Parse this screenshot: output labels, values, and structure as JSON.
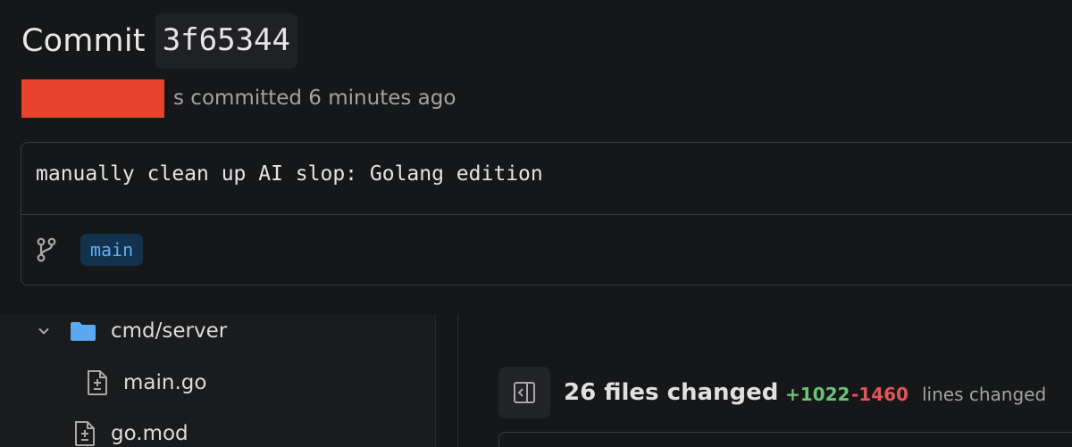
{
  "commit": {
    "title_word": "Commit",
    "sha": "3f65344",
    "author": "",
    "committed_text": "s committed 6 minutes ago",
    "message": "manually clean up AI slop: Golang edition",
    "branch": "main"
  },
  "file_tree": {
    "items": [
      {
        "label": "cmd/server",
        "type": "folder",
        "expanded": true,
        "icon": "folder-icon"
      },
      {
        "label": "main.go",
        "type": "file",
        "icon": "file-diff-icon"
      },
      {
        "label": "go.mod",
        "type": "file",
        "icon": "file-diff-icon"
      }
    ]
  },
  "summary": {
    "files_changed": "26 files changed",
    "additions": "+1022",
    "deletions": "-1460",
    "lines_changed_label": "lines changed",
    "toggle_icon": "sidebar-collapse-icon"
  },
  "colors": {
    "background": "#161718",
    "redaction": "#e8432b",
    "branch_bg": "#13324d",
    "branch_text": "#61aef5",
    "additions": "#6cc27a",
    "deletions": "#e0565b",
    "folder": "#5ba8f2"
  }
}
